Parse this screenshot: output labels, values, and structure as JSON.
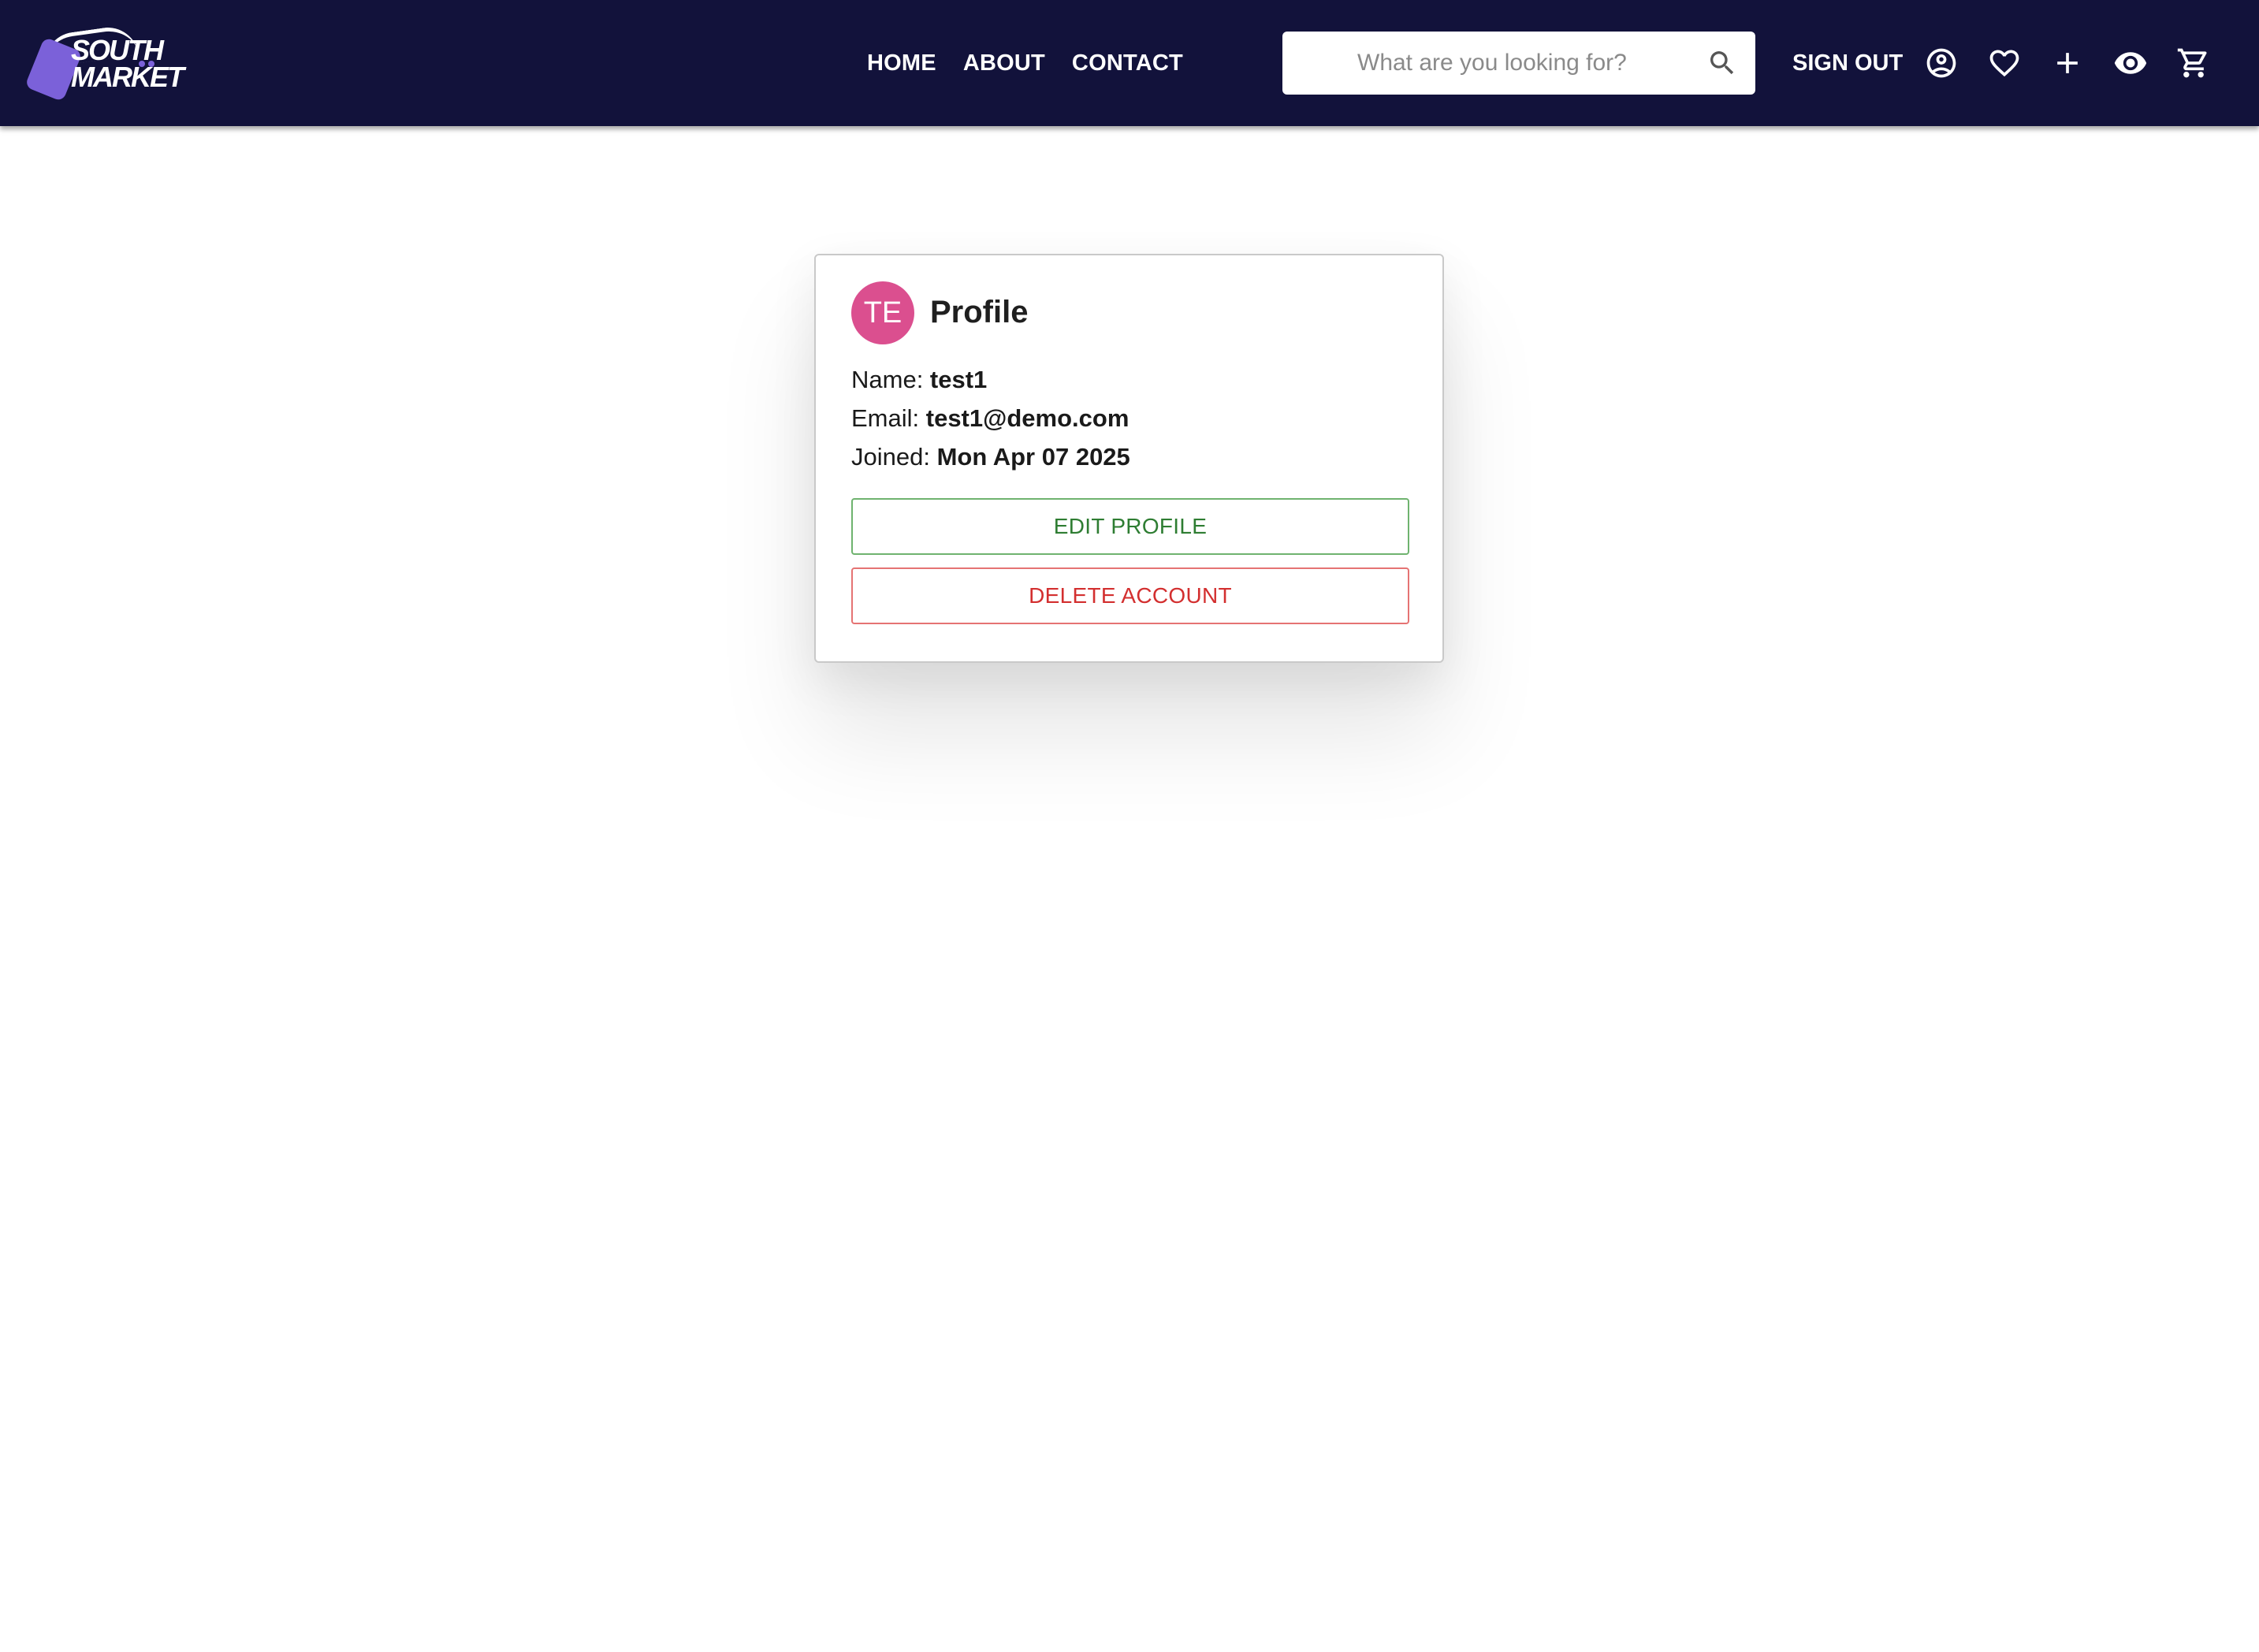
{
  "header": {
    "logo_line1": "SOUTH",
    "logo_line2": "MARKET",
    "nav": [
      {
        "label": "HOME"
      },
      {
        "label": "ABOUT"
      },
      {
        "label": "CONTACT"
      }
    ],
    "search_placeholder": "What are you looking for?",
    "sign_out_label": "SIGN OUT",
    "icons": [
      "search-icon",
      "account-circle-icon",
      "heart-icon",
      "plus-icon",
      "eye-icon",
      "cart-icon"
    ],
    "colors": {
      "background": "#12123b",
      "logo_accent": "#7b61d9"
    }
  },
  "profile": {
    "avatar_initials": "TE",
    "avatar_color": "#db4f8f",
    "title": "Profile",
    "name_label": "Name:",
    "name_value": "test1",
    "email_label": "Email:",
    "email_value": "test1@demo.com",
    "joined_label": "Joined:",
    "joined_value": "Mon Apr 07 2025",
    "edit_button": "EDIT PROFILE",
    "delete_button": "DELETE ACCOUNT",
    "colors": {
      "edit": "#2e7d32",
      "delete": "#d32f2f"
    }
  }
}
